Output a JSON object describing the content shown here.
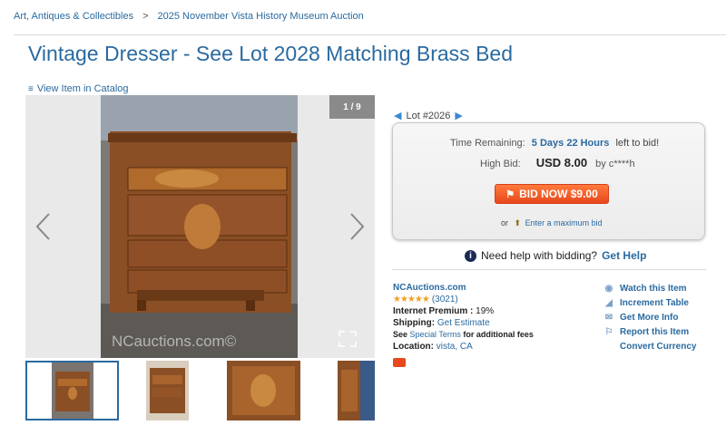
{
  "breadcrumb": {
    "items": [
      "Art, Antiques & Collectibles",
      "2025 November Vista History Museum Auction"
    ],
    "separator": ">"
  },
  "title": "Vintage Dresser - See Lot 2028 Matching Brass Bed",
  "catalog_link": "View Item in Catalog",
  "viewer": {
    "counter": "1 / 9",
    "watermark": "NCauctions.com©"
  },
  "thumbnails": [
    {
      "label": "thumbnail 1",
      "selected": true
    },
    {
      "label": "thumbnail 2",
      "selected": false
    },
    {
      "label": "thumbnail 3",
      "selected": false
    },
    {
      "label": "thumbnail 4",
      "selected": false
    }
  ],
  "lot": {
    "label": "Lot #2026"
  },
  "bidding": {
    "time_label": "Time Remaining:",
    "time_value": "5 Days 22 Hours",
    "time_suffix": "left to bid!",
    "high_label": "High Bid:",
    "high_amount": "USD 8.00",
    "high_by": "by c****h",
    "bid_button": "BID NOW $9.00",
    "or_label": "or",
    "max_bid_link": "Enter a maximum bid"
  },
  "help": {
    "text": "Need help with bidding?",
    "link": "Get Help"
  },
  "seller": {
    "name": "NCAuctions.com",
    "stars": "★★★★★",
    "reviews": "(3021)",
    "premium_label": "Internet Premium :",
    "premium_value": "19%",
    "shipping_label": "Shipping:",
    "shipping_link": "Get Estimate",
    "terms_prefix": "See",
    "terms_link": "Special Terms",
    "terms_suffix": "for additional fees",
    "location_label": "Location:",
    "location_value": "vista, CA"
  },
  "actions": [
    {
      "label": "Watch this Item",
      "icon": "eye-icon"
    },
    {
      "label": "Increment Table",
      "icon": "increment-icon"
    },
    {
      "label": "Get More Info",
      "icon": "envelope-icon"
    },
    {
      "label": "Report this Item",
      "icon": "flag-icon"
    },
    {
      "label": "Convert Currency",
      "icon": "currency-icon"
    }
  ],
  "colors": {
    "link": "#2a6aa0",
    "bid_button": "#e8481c",
    "stars": "#f0a020"
  }
}
